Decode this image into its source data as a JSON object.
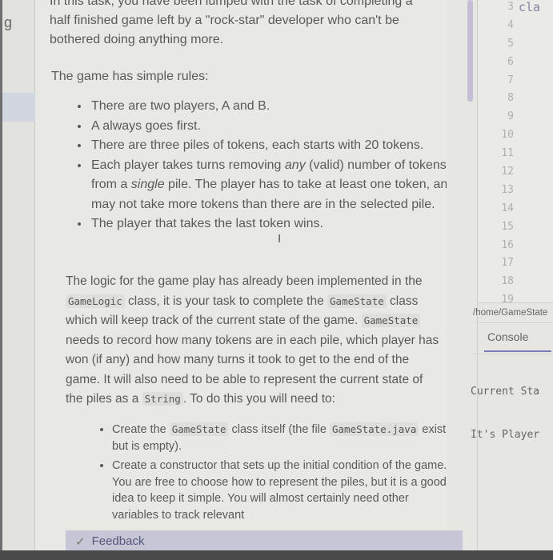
{
  "sidebar": {
    "glyph": "g",
    "active_item_highlight": "#d2d6e0"
  },
  "instructions": {
    "intro_line_cut": "In this task, you have been lumped with the task of completing a",
    "intro_line_2": "half finished game left by a \"rock-star\" developer who can't be",
    "intro_line_3": "bothered doing anything more.",
    "rules_heading": "The game has simple rules:",
    "rules": [
      {
        "text": "There are two players, A and B."
      },
      {
        "text": "A always goes first."
      },
      {
        "text": "There are three piles of tokens, each starts with 20 tokens."
      },
      {
        "pre": "Each player takes turns removing ",
        "em1": "any",
        "mid": " (valid) number of tokens from a ",
        "em2": "single",
        "post": " pile. The player has to take at least one token, and may not take more tokens than there are in the selected pile."
      },
      {
        "text": "The player that takes the last token wins."
      }
    ],
    "logic": {
      "t1": "The logic for the game play has already been implemented in the ",
      "c1": "GameLogic",
      "t2": " class, it is your task to complete the ",
      "c2": "GameState",
      "t3": " class which will keep track of the current state of the game. ",
      "c3": "GameState",
      "t4": " needs to record how many tokens are in each pile, which player has won (if any) and how many turns it took to get to the end of the game. It will also need to be able to represent the current state of the piles as a ",
      "c4": "String",
      "t5": ". To do this you will need to:"
    },
    "tasks": [
      {
        "pre": "Create the ",
        "code1": "GameState",
        "mid": " class itself (the file ",
        "code2": "GameState.java",
        "post": " exists, but is empty)."
      },
      {
        "text": "Create a constructor that sets up the initial condition of the game. You are free to choose how to represent the piles, but it is a good idea to keep it simple. You will almost certainly need other variables to track relevant"
      }
    ],
    "cursor_glyph": "I"
  },
  "feedback": {
    "check_icon": "✓",
    "label": "Feedback"
  },
  "editor": {
    "line_numbers": [
      "3",
      "4",
      "5",
      "6",
      "7",
      "8",
      "9",
      "10",
      "11",
      "12",
      "13",
      "14",
      "15",
      "16",
      "17",
      "18",
      "19"
    ],
    "visible_code_line_3": "cla",
    "file_path": "/home/GameState"
  },
  "console": {
    "tab_label": "Console",
    "output_lines": [
      "Current Sta",
      "It's Player"
    ]
  },
  "colors": {
    "accent": "#7c7cb8",
    "scroll_thumb": "#c6bed6",
    "feedback_bar": "#c6c6d6"
  }
}
